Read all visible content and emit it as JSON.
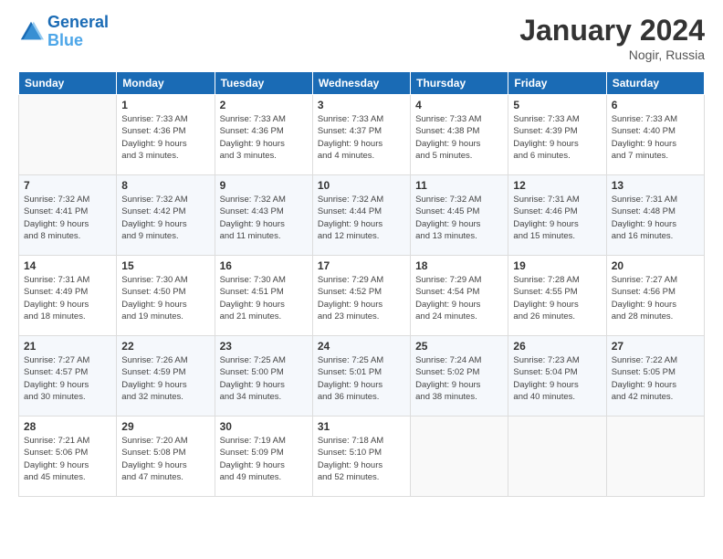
{
  "header": {
    "logo_line1": "General",
    "logo_line2": "Blue",
    "title": "January 2024",
    "subtitle": "Nogir, Russia"
  },
  "columns": [
    "Sunday",
    "Monday",
    "Tuesday",
    "Wednesday",
    "Thursday",
    "Friday",
    "Saturday"
  ],
  "weeks": [
    [
      {
        "day": "",
        "info": ""
      },
      {
        "day": "1",
        "info": "Sunrise: 7:33 AM\nSunset: 4:36 PM\nDaylight: 9 hours\nand 3 minutes."
      },
      {
        "day": "2",
        "info": "Sunrise: 7:33 AM\nSunset: 4:36 PM\nDaylight: 9 hours\nand 3 minutes."
      },
      {
        "day": "3",
        "info": "Sunrise: 7:33 AM\nSunset: 4:37 PM\nDaylight: 9 hours\nand 4 minutes."
      },
      {
        "day": "4",
        "info": "Sunrise: 7:33 AM\nSunset: 4:38 PM\nDaylight: 9 hours\nand 5 minutes."
      },
      {
        "day": "5",
        "info": "Sunrise: 7:33 AM\nSunset: 4:39 PM\nDaylight: 9 hours\nand 6 minutes."
      },
      {
        "day": "6",
        "info": "Sunrise: 7:33 AM\nSunset: 4:40 PM\nDaylight: 9 hours\nand 7 minutes."
      }
    ],
    [
      {
        "day": "7",
        "info": "Sunrise: 7:32 AM\nSunset: 4:41 PM\nDaylight: 9 hours\nand 8 minutes."
      },
      {
        "day": "8",
        "info": "Sunrise: 7:32 AM\nSunset: 4:42 PM\nDaylight: 9 hours\nand 9 minutes."
      },
      {
        "day": "9",
        "info": "Sunrise: 7:32 AM\nSunset: 4:43 PM\nDaylight: 9 hours\nand 11 minutes."
      },
      {
        "day": "10",
        "info": "Sunrise: 7:32 AM\nSunset: 4:44 PM\nDaylight: 9 hours\nand 12 minutes."
      },
      {
        "day": "11",
        "info": "Sunrise: 7:32 AM\nSunset: 4:45 PM\nDaylight: 9 hours\nand 13 minutes."
      },
      {
        "day": "12",
        "info": "Sunrise: 7:31 AM\nSunset: 4:46 PM\nDaylight: 9 hours\nand 15 minutes."
      },
      {
        "day": "13",
        "info": "Sunrise: 7:31 AM\nSunset: 4:48 PM\nDaylight: 9 hours\nand 16 minutes."
      }
    ],
    [
      {
        "day": "14",
        "info": "Sunrise: 7:31 AM\nSunset: 4:49 PM\nDaylight: 9 hours\nand 18 minutes."
      },
      {
        "day": "15",
        "info": "Sunrise: 7:30 AM\nSunset: 4:50 PM\nDaylight: 9 hours\nand 19 minutes."
      },
      {
        "day": "16",
        "info": "Sunrise: 7:30 AM\nSunset: 4:51 PM\nDaylight: 9 hours\nand 21 minutes."
      },
      {
        "day": "17",
        "info": "Sunrise: 7:29 AM\nSunset: 4:52 PM\nDaylight: 9 hours\nand 23 minutes."
      },
      {
        "day": "18",
        "info": "Sunrise: 7:29 AM\nSunset: 4:54 PM\nDaylight: 9 hours\nand 24 minutes."
      },
      {
        "day": "19",
        "info": "Sunrise: 7:28 AM\nSunset: 4:55 PM\nDaylight: 9 hours\nand 26 minutes."
      },
      {
        "day": "20",
        "info": "Sunrise: 7:27 AM\nSunset: 4:56 PM\nDaylight: 9 hours\nand 28 minutes."
      }
    ],
    [
      {
        "day": "21",
        "info": "Sunrise: 7:27 AM\nSunset: 4:57 PM\nDaylight: 9 hours\nand 30 minutes."
      },
      {
        "day": "22",
        "info": "Sunrise: 7:26 AM\nSunset: 4:59 PM\nDaylight: 9 hours\nand 32 minutes."
      },
      {
        "day": "23",
        "info": "Sunrise: 7:25 AM\nSunset: 5:00 PM\nDaylight: 9 hours\nand 34 minutes."
      },
      {
        "day": "24",
        "info": "Sunrise: 7:25 AM\nSunset: 5:01 PM\nDaylight: 9 hours\nand 36 minutes."
      },
      {
        "day": "25",
        "info": "Sunrise: 7:24 AM\nSunset: 5:02 PM\nDaylight: 9 hours\nand 38 minutes."
      },
      {
        "day": "26",
        "info": "Sunrise: 7:23 AM\nSunset: 5:04 PM\nDaylight: 9 hours\nand 40 minutes."
      },
      {
        "day": "27",
        "info": "Sunrise: 7:22 AM\nSunset: 5:05 PM\nDaylight: 9 hours\nand 42 minutes."
      }
    ],
    [
      {
        "day": "28",
        "info": "Sunrise: 7:21 AM\nSunset: 5:06 PM\nDaylight: 9 hours\nand 45 minutes."
      },
      {
        "day": "29",
        "info": "Sunrise: 7:20 AM\nSunset: 5:08 PM\nDaylight: 9 hours\nand 47 minutes."
      },
      {
        "day": "30",
        "info": "Sunrise: 7:19 AM\nSunset: 5:09 PM\nDaylight: 9 hours\nand 49 minutes."
      },
      {
        "day": "31",
        "info": "Sunrise: 7:18 AM\nSunset: 5:10 PM\nDaylight: 9 hours\nand 52 minutes."
      },
      {
        "day": "",
        "info": ""
      },
      {
        "day": "",
        "info": ""
      },
      {
        "day": "",
        "info": ""
      }
    ]
  ]
}
